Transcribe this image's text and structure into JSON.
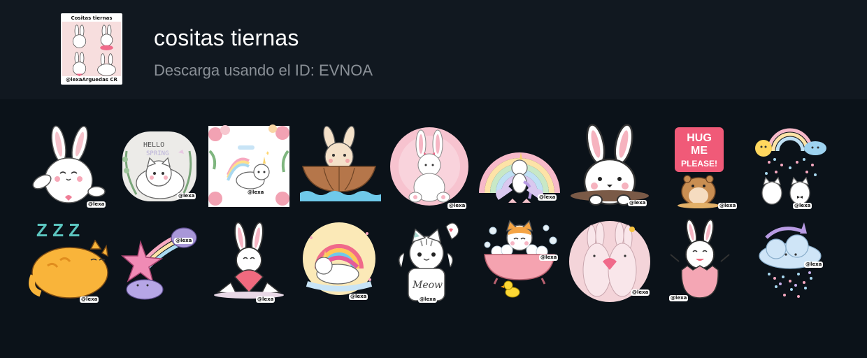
{
  "pack": {
    "title": "cositas tiernas",
    "download_text": "Descarga usando el ID: EVNOA",
    "thumb_title": "Cositas tiernas",
    "thumb_credit": "@lexaArguedas CR"
  },
  "stickers": [
    {
      "icon": "bunny-waving-icon",
      "credit": "@lexa"
    },
    {
      "icon": "hello-spring-cat-icon",
      "text": "HELLO SPRING",
      "credit": "@lexa"
    },
    {
      "icon": "unicorn-cat-flowers-icon",
      "credit": "@lexa"
    },
    {
      "icon": "bunny-boat-icon",
      "credit": "@lexa"
    },
    {
      "icon": "pink-bunny-bow-icon",
      "credit": "@lexa"
    },
    {
      "icon": "rainbow-unicorn-cat-icon",
      "credit": "@lexa"
    },
    {
      "icon": "bunny-peeking-icon",
      "credit": "@lexa"
    },
    {
      "icon": "hug-me-hamster-icon",
      "text": "HUG ME PLEASE!",
      "credit": "@lexa"
    },
    {
      "icon": "rainbow-cats-icon",
      "credit": "@lexa"
    },
    {
      "icon": "sleeping-orange-cat-icon",
      "text": "Z Z Z",
      "credit": "@lexa"
    },
    {
      "icon": "star-rainbow-cloud-icon",
      "credit": "@lexa"
    },
    {
      "icon": "bunny-heart-icon",
      "credit": "@lexa"
    },
    {
      "icon": "unicorn-rainbow-icon",
      "credit": "@lexa"
    },
    {
      "icon": "meow-cat-icon",
      "text": "Meow",
      "credit": "@lexa"
    },
    {
      "icon": "cat-bathtub-icon",
      "credit": "@lexa"
    },
    {
      "icon": "hugging-bunnies-icon",
      "credit": "@lexa"
    },
    {
      "icon": "bunny-egg-icon",
      "credit": "@lexa"
    },
    {
      "icon": "unicorn-cloud-icon",
      "credit": "@lexa"
    }
  ]
}
